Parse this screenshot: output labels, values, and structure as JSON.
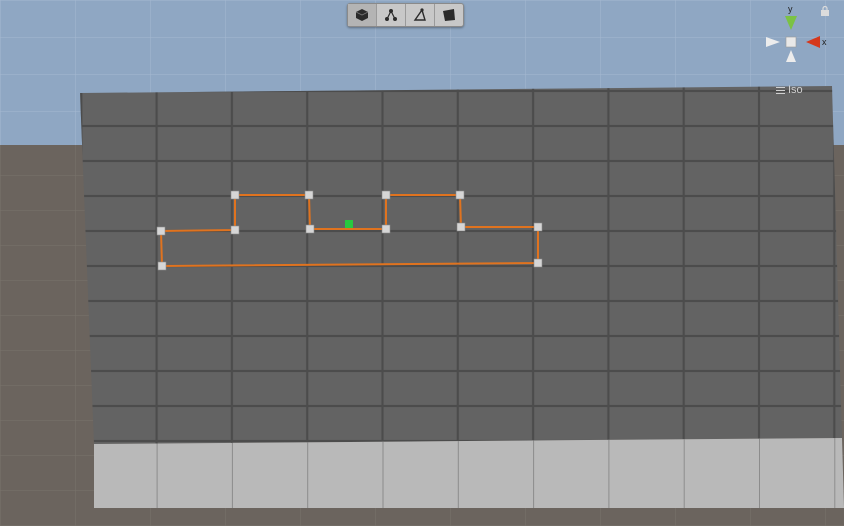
{
  "colors": {
    "sky": "#8fa7c3",
    "ground": "#6b645e",
    "plane_top": "#636363",
    "plane_front": "#b9b9b9",
    "collider_outline": "#e0731f",
    "point_handle": "#d6d6d6",
    "center_handle": "#27c93f",
    "axis_x": "#d5381c",
    "axis_y": "#7bc244",
    "axis_z": "#3a6fd9"
  },
  "toolbar": {
    "tools": [
      {
        "name": "edit-shape-tool",
        "icon": "cube-icon",
        "active": true
      },
      {
        "name": "edit-points-tool",
        "icon": "vertex-nodes-icon",
        "active": false
      },
      {
        "name": "edit-edges-tool",
        "icon": "edge-angle-icon",
        "active": false
      },
      {
        "name": "edit-faces-tool",
        "icon": "face-icon",
        "active": false
      }
    ]
  },
  "gizmo": {
    "y_label": "y",
    "x_label": "x",
    "projection_label": "Iso"
  }
}
